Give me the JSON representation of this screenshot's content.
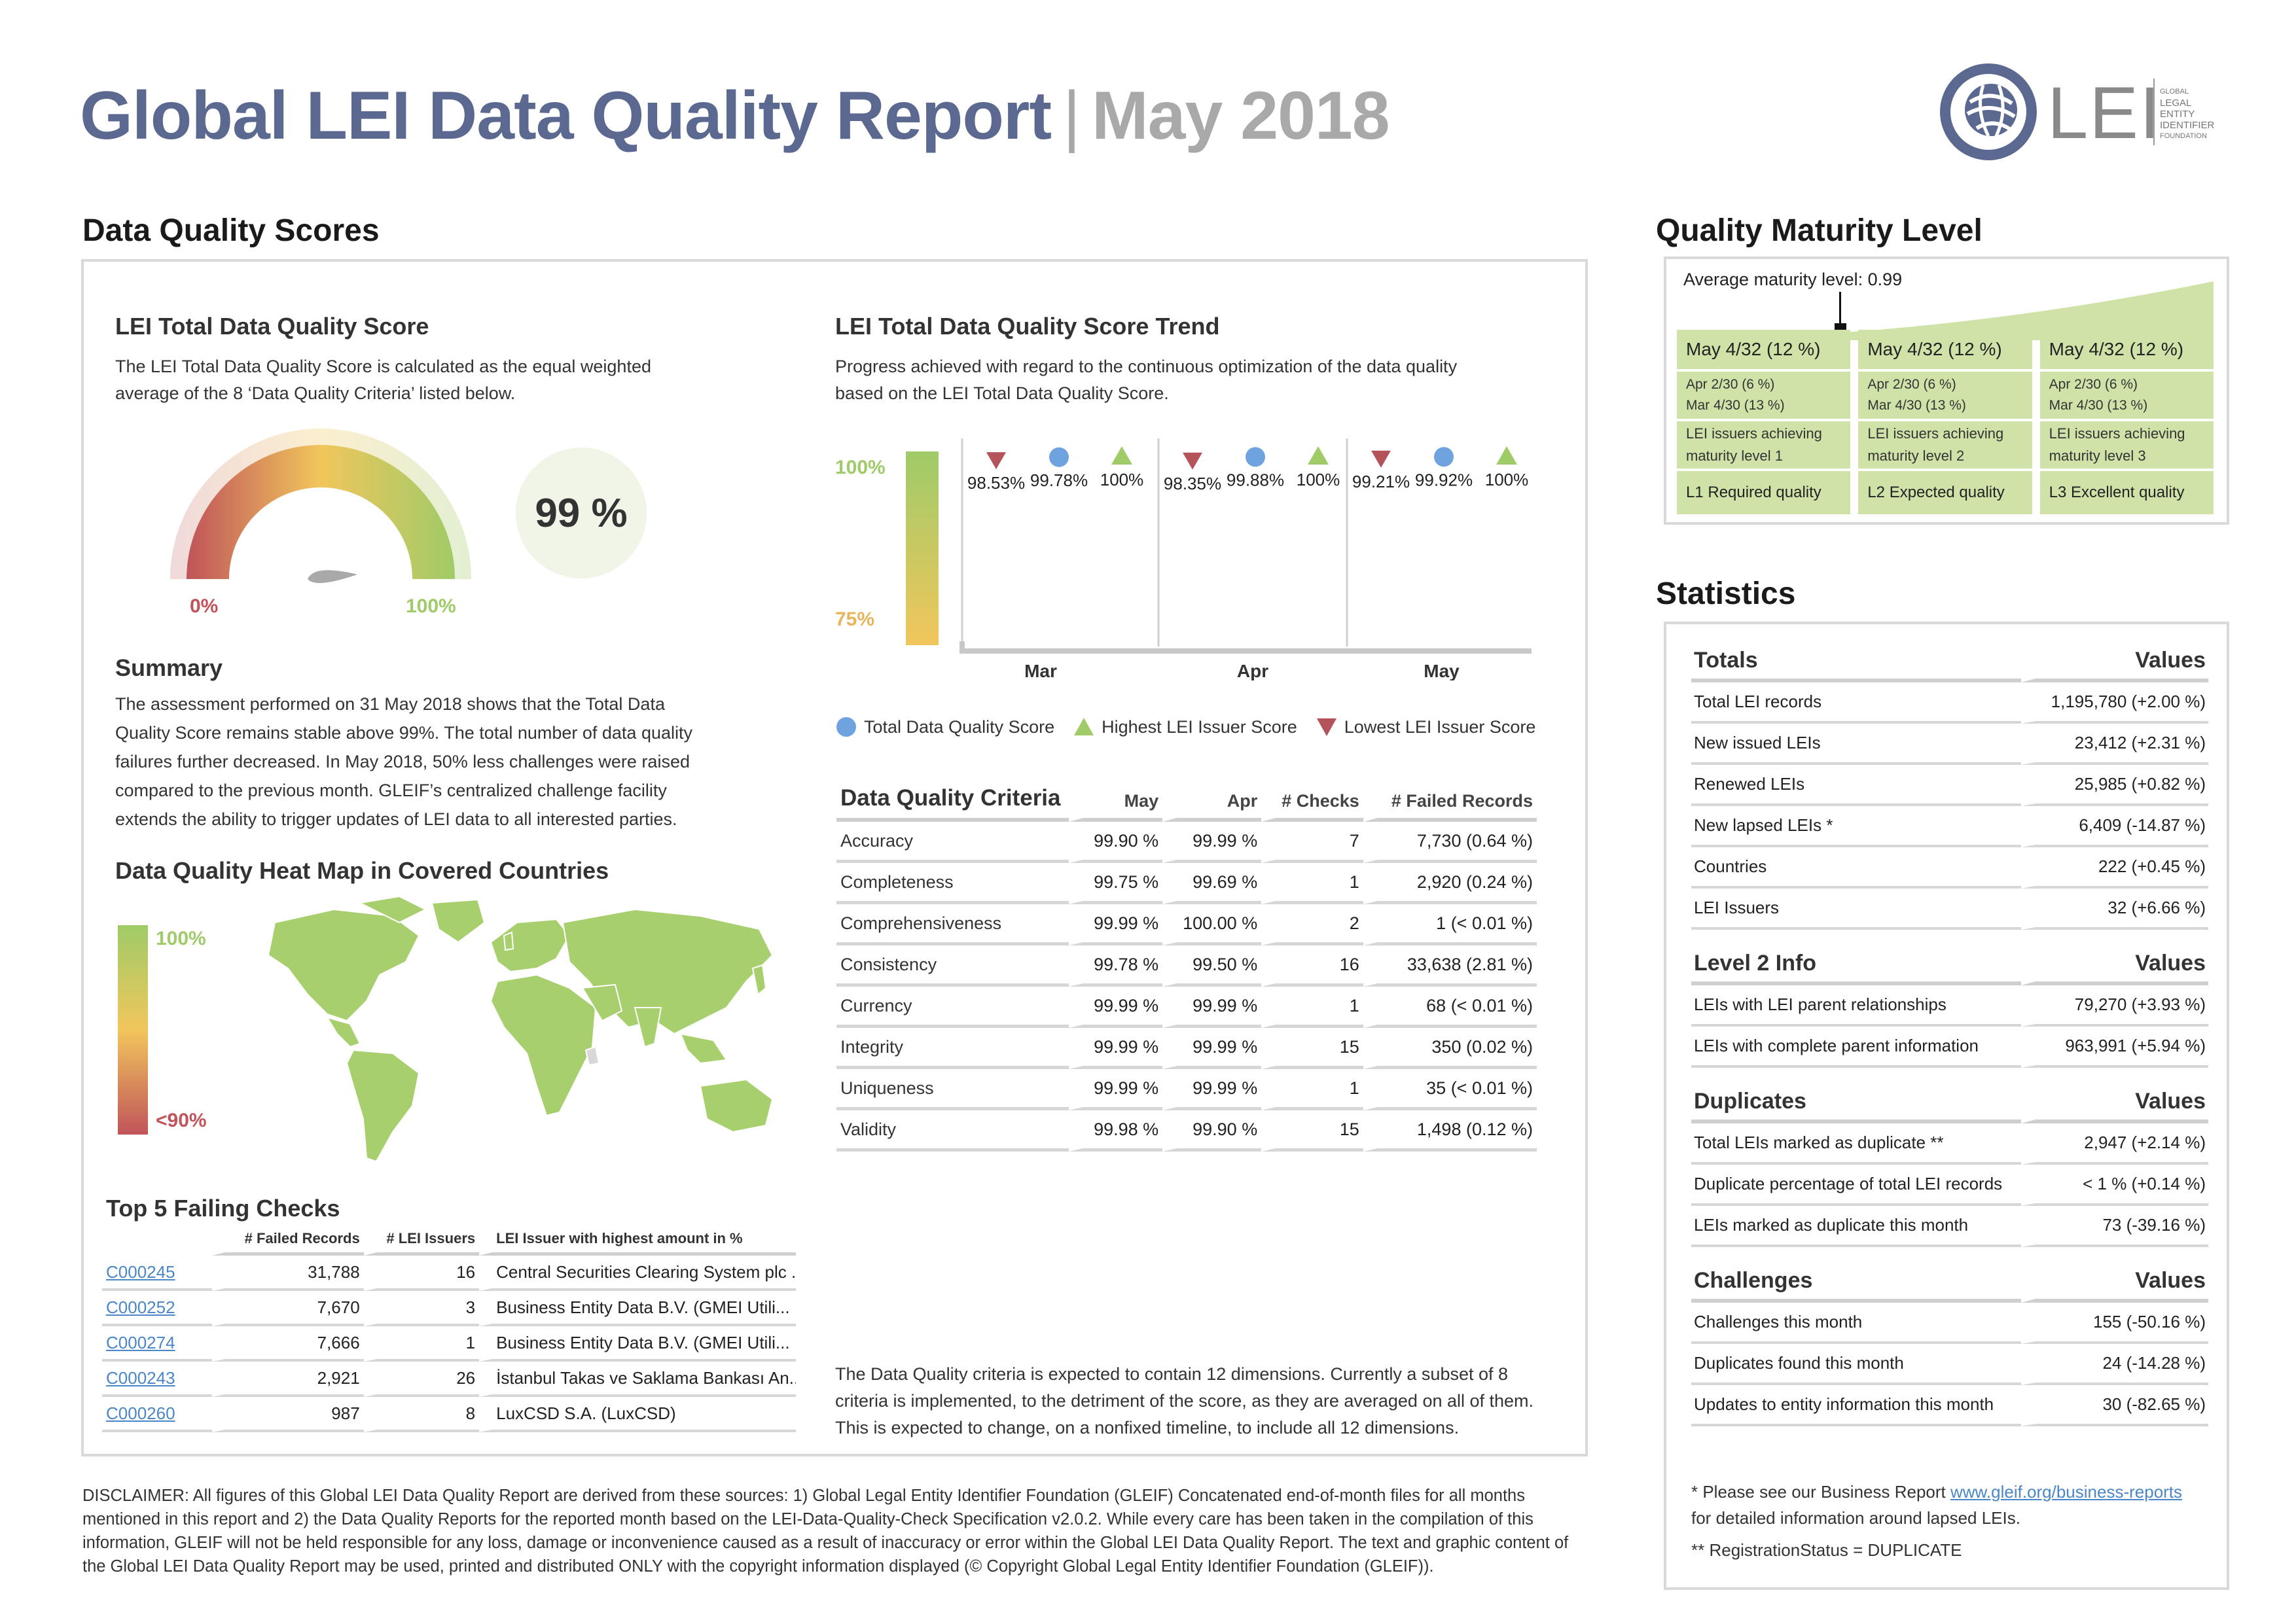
{
  "header": {
    "title": "Global LEI Data Quality Report",
    "separator": "|",
    "month": "May 2018",
    "logo_text": "LEI",
    "logo_sub": [
      "GLOBAL",
      "LEGAL",
      "ENTITY",
      "IDENTIFIER",
      "FOUNDATION"
    ]
  },
  "scores": {
    "section_title": "Data Quality Scores",
    "total": {
      "title": "LEI Total Data Quality Score",
      "description": "The LEI Total Data Quality Score is calculated as the equal weighted average of the 8 ‘Data Quality Criteria’ listed below.",
      "gauge_min_label": "0%",
      "gauge_max_label": "100%",
      "score_label": "99 %",
      "gauge_value": 99
    },
    "summary": {
      "title": "Summary",
      "text": "The assessment performed on 31 May 2018 shows that the Total Data Quality Score remains stable above 99%. The total number of data quality failures further decreased. In May 2018, 50% less challenges were raised compared to the previous month. GLEIF’s centralized challenge facility extends the ability to trigger updates of LEI data to all interested parties."
    },
    "heatmap": {
      "title": "Data Quality Heat Map in Covered Countries",
      "scale_top": "100%",
      "scale_bottom": "<90%"
    },
    "trend": {
      "title": "LEI Total Data Quality Score Trend",
      "description": "Progress achieved with regard to the continuous optimization of the data quality based on the LEI Total Data Quality Score.",
      "axis_top": "100%",
      "axis_bottom": "75%"
    },
    "criteria": {
      "title": "Data Quality Criteria",
      "columns": [
        "May",
        "Apr",
        "# Checks",
        "# Failed Records"
      ],
      "rows": [
        {
          "name": "Accuracy",
          "may": "99.90 %",
          "apr": "99.99 %",
          "checks": "7",
          "failed": "7,730 (0.64 %)"
        },
        {
          "name": "Completeness",
          "may": "99.75 %",
          "apr": "99.69 %",
          "checks": "1",
          "failed": "2,920 (0.24 %)"
        },
        {
          "name": "Comprehensiveness",
          "may": "99.99 %",
          "apr": "100.00 %",
          "checks": "2",
          "failed": "1 (< 0.01 %)"
        },
        {
          "name": "Consistency",
          "may": "99.78 %",
          "apr": "99.50 %",
          "checks": "16",
          "failed": "33,638 (2.81 %)"
        },
        {
          "name": "Currency",
          "may": "99.99 %",
          "apr": "99.99 %",
          "checks": "1",
          "failed": "68 (< 0.01 %)"
        },
        {
          "name": "Integrity",
          "may": "99.99 %",
          "apr": "99.99 %",
          "checks": "15",
          "failed": "350 (0.02 %)"
        },
        {
          "name": "Uniqueness",
          "may": "99.99 %",
          "apr": "99.99 %",
          "checks": "1",
          "failed": "35 (< 0.01 %)"
        },
        {
          "name": "Validity",
          "may": "99.98 %",
          "apr": "99.90 %",
          "checks": "15",
          "failed": "1,498 (0.12 %)"
        }
      ],
      "note": "The Data Quality criteria is expected to contain 12 dimensions. Currently a subset of 8 criteria is implemented, to the detriment of the score, as they are averaged on all of them. This is expected to change, on a nonfixed timeline, to include all 12 dimensions."
    },
    "failing": {
      "title": "Top 5 Failing Checks",
      "columns": [
        "# Failed Records",
        "# LEI Issuers",
        "LEI Issuer with highest amount in %"
      ],
      "rows": [
        {
          "id": "C000245",
          "failed": "31,788",
          "issuers": "16",
          "issuer": "Central Securities Clearing System plc ..."
        },
        {
          "id": "C000252",
          "failed": "7,670",
          "issuers": "3",
          "issuer": "Business Entity Data B.V. (GMEI Utili..."
        },
        {
          "id": "C000274",
          "failed": "7,666",
          "issuers": "1",
          "issuer": "Business Entity Data B.V. (GMEI Utili..."
        },
        {
          "id": "C000243",
          "failed": "2,921",
          "issuers": "26",
          "issuer": "İstanbul Takas ve Saklama Bankası An..."
        },
        {
          "id": "C000260",
          "failed": "987",
          "issuers": "8",
          "issuer": "LuxCSD S.A. (LuxCSD)"
        }
      ]
    }
  },
  "chart_data": {
    "type": "scatter",
    "categories": [
      "Mar",
      "Apr",
      "May"
    ],
    "series": [
      {
        "name": "Lowest LEI Issuer Score",
        "values": [
          98.53,
          98.35,
          99.21
        ],
        "labels": [
          "98.53%",
          "98.35%",
          "99.21%"
        ]
      },
      {
        "name": "Total Data Quality Score",
        "values": [
          99.78,
          99.88,
          99.92
        ],
        "labels": [
          "99.78%",
          "99.88%",
          "99.92%"
        ]
      },
      {
        "name": "Highest LEI Issuer Score",
        "values": [
          100,
          100,
          100
        ],
        "labels": [
          "100%",
          "100%",
          "100%"
        ]
      }
    ],
    "ylim": [
      75,
      100
    ],
    "legend": "bottom",
    "colors": {
      "total": "#6fa3e0",
      "highest": "#9fcb68",
      "lowest": "#b5535a"
    }
  },
  "maturity": {
    "section_title": "Quality Maturity Level",
    "average_label": "Average maturity level: 0.99",
    "average_value": 0.99,
    "levels": [
      {
        "headline": "May 4/32 (12 %)",
        "apr": "Apr 2/30 (6 %)",
        "mar": "Mar 4/30 (13 %)",
        "desc1": "LEI issuers achieving",
        "desc2": "maturity level 1",
        "label": "L1 Required quality"
      },
      {
        "headline": "May 4/32 (12 %)",
        "apr": "Apr 2/30 (6 %)",
        "mar": "Mar 4/30 (13 %)",
        "desc1": "LEI issuers achieving",
        "desc2": "maturity level 2",
        "label": "L2 Expected quality"
      },
      {
        "headline": "May 4/32 (12 %)",
        "apr": "Apr 2/30 (6 %)",
        "mar": "Mar 4/30 (13 %)",
        "desc1": "LEI issuers achieving",
        "desc2": "maturity level 3",
        "label": "L3 Excellent quality"
      }
    ]
  },
  "statistics": {
    "section_title": "Statistics",
    "values_label": "Values",
    "totals": {
      "title": "Totals",
      "rows": [
        {
          "label": "Total LEI records",
          "value": "1,195,780 (+2.00 %)"
        },
        {
          "label": "New issued LEIs",
          "value": "23,412 (+2.31 %)"
        },
        {
          "label": "Renewed LEIs",
          "value": "25,985 (+0.82 %)"
        },
        {
          "label": "New lapsed LEIs *",
          "value": "6,409 (-14.87 %)"
        },
        {
          "label": "Countries",
          "value": "222 (+0.45 %)"
        },
        {
          "label": "LEI Issuers",
          "value": "32 (+6.66 %)"
        }
      ]
    },
    "level2": {
      "title": "Level 2 Info",
      "rows": [
        {
          "label": "LEIs with LEI parent relationships",
          "value": "79,270 (+3.93 %)"
        },
        {
          "label": "LEIs with complete parent information",
          "value": "963,991 (+5.94 %)"
        }
      ]
    },
    "duplicates": {
      "title": "Duplicates",
      "rows": [
        {
          "label": "Total LEIs marked as duplicate **",
          "value": "2,947 (+2.14 %)"
        },
        {
          "label": "Duplicate percentage of total LEI records",
          "value": "< 1 % (+0.14 %)"
        },
        {
          "label": "LEIs marked as duplicate this month",
          "value": "73 (-39.16 %)"
        }
      ]
    },
    "challenges": {
      "title": "Challenges",
      "rows": [
        {
          "label": "Challenges this month",
          "value": "155 (-50.16 %)"
        },
        {
          "label": "Duplicates found this month",
          "value": "24 (-14.28 %)"
        },
        {
          "label": "Updates to entity information this month",
          "value": "30 (-82.65 %)"
        }
      ]
    },
    "footnote1_prefix": "* Please see our Business Report ",
    "footnote1_link": "www.gleif.org/business-reports",
    "footnote1_suffix": "for detailed information around lapsed LEIs.",
    "footnote2": "** RegistrationStatus = DUPLICATE"
  },
  "disclaimer": "DISCLAIMER: All figures of this Global LEI Data Quality Report are derived from these sources: 1) Global Legal Entity Identifier Foundation (GLEIF) Concatenated end-of-month files for all months mentioned in this report and 2) the Data Quality Reports for the reported month based on the LEI-Data-Quality-Check Specification v2.0.2. While every care has been taken in the compilation of this information, GLEIF will not be held responsible for any loss, damage or inconvenience caused as a result of inaccuracy or error within the Global LEI Data Quality Report. The text and graphic content of the Global LEI Data Quality Report may be used, printed and distributed ONLY with the copyright information displayed (© Copyright Global Legal Entity Identifier Foundation (GLEIF))."
}
